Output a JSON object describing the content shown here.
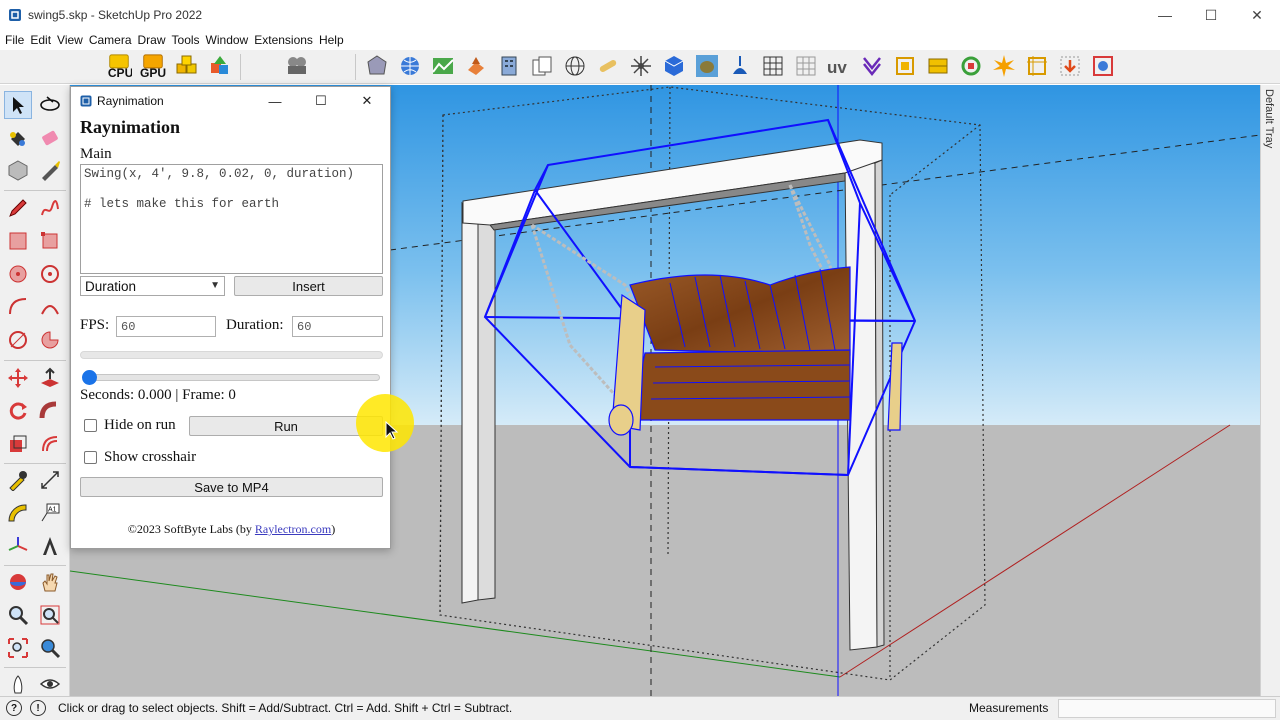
{
  "window": {
    "title": "swing5.skp - SketchUp Pro 2022",
    "minimize": "—",
    "maximize": "☐",
    "close": "✕"
  },
  "menu": [
    "File",
    "Edit",
    "View",
    "Camera",
    "Draw",
    "Tools",
    "Window",
    "Extensions",
    "Help"
  ],
  "toolbar_icons": [
    "cpu-render-icon",
    "gpu-render-icon",
    "components-icon",
    "shapes-icon",
    "film-reel-icon",
    "gem-icon",
    "globe-icon",
    "terrain-icon",
    "sandbox-icon",
    "building-icon",
    "documents-icon",
    "wireframe-sphere-icon",
    "scroll-icon",
    "sun-icon",
    "cube-icon",
    "stone-icon",
    "lamp-icon",
    "grid-icon",
    "grid-light-icon",
    "uv-icon",
    "arrow-down-icon",
    "frame-icon",
    "frame-filled-icon",
    "refresh-icon",
    "burst-icon",
    "crop-icon",
    "export-icon",
    "gear-frame-icon"
  ],
  "left_tools": [
    "select-icon",
    "orbit-icon",
    "paint-bucket-icon",
    "eraser-icon",
    "component-icon",
    "tape-icon",
    "pencil-icon",
    "freehand-icon",
    "rectangle-icon",
    "rotated-rectangle-icon",
    "circle-icon",
    "polygon-icon",
    "arc-icon",
    "arc-2pt-icon",
    "arc-3pt-icon",
    "pie-icon",
    "move-icon",
    "push-pull-icon",
    "rotate-icon",
    "follow-me-icon",
    "scale-icon",
    "offset-icon",
    "tape-measure-icon",
    "dimension-icon",
    "protractor-icon",
    "text-icon",
    "axes-icon",
    "3d-text-icon",
    "orbit-tool-icon",
    "pan-icon",
    "zoom-icon",
    "zoom-window-icon",
    "zoom-extents-icon",
    "previous-view-icon",
    "walk-icon",
    "look-around-icon"
  ],
  "tray": {
    "label": "Default Tray"
  },
  "status": {
    "text": "Click or drag to select objects. Shift = Add/Subtract. Ctrl = Add. Shift + Ctrl = Subtract.",
    "measurements_label": "Measurements",
    "measurements_value": ""
  },
  "dialog": {
    "window_title": "Raynimation",
    "heading": "Raynimation",
    "main_label": "Main",
    "code": "Swing(x, 4', 9.8, 0.02, 0, duration)\n\n# lets make this for earth",
    "select_value": "Duration",
    "insert_label": "Insert",
    "fps_label": "FPS:",
    "fps_value": "60",
    "duration_label": "Duration:",
    "duration_value": "60",
    "progress": 0,
    "slider_value": 0,
    "seconds_text": "Seconds: 0.000 | Frame: 0",
    "hide_on_run_label": "Hide on run",
    "hide_on_run_checked": false,
    "run_label": "Run",
    "show_crosshair_label": "Show crosshair",
    "show_crosshair_checked": false,
    "save_label": "Save to MP4",
    "footer_prefix": "©2023 SoftByte Labs (by ",
    "footer_link": "Raylectron.com",
    "footer_suffix": ")"
  },
  "colors": {
    "sky_top": "#3a9ee4",
    "sky_bottom": "#cfe8f7",
    "ground": "#b9b9b9",
    "selection_blue": "#1010ff",
    "wood": "#8a4a1c",
    "accent": "#1a73e8",
    "cursor_highlight": "#ffe600"
  }
}
